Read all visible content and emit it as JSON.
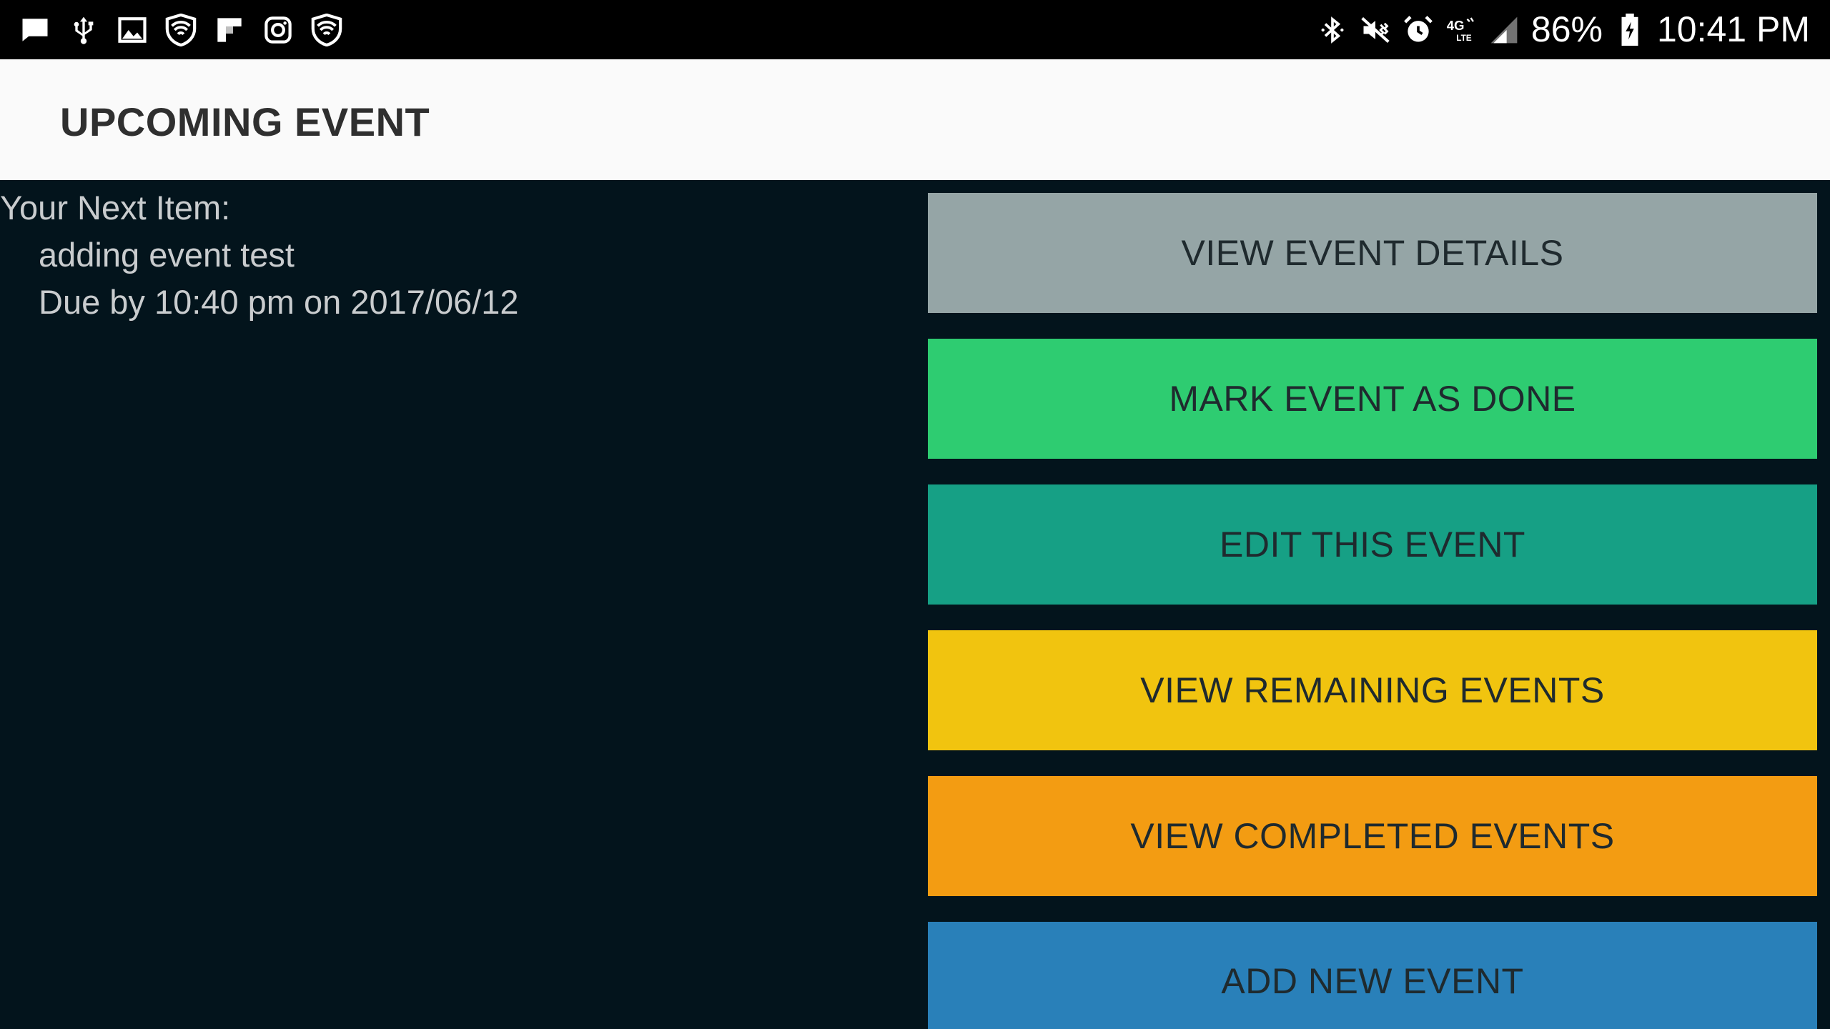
{
  "status_bar": {
    "battery": "86%",
    "time": "10:41 PM",
    "left_icons": [
      "message-icon",
      "usb-icon",
      "image-icon",
      "shield-wifi-icon",
      "flipboard-icon",
      "instagram-icon",
      "shield-wifi-icon"
    ],
    "right_icons": [
      "bluetooth-icon",
      "mute-icon",
      "alarm-icon",
      "lte-icon",
      "signal-icon",
      "battery-icon"
    ]
  },
  "app_bar": {
    "title": "UPCOMING EVENT"
  },
  "event": {
    "heading": "Your Next Item:",
    "name": "adding event test",
    "due": "Due by 10:40 pm on 2017/06/12"
  },
  "buttons": [
    {
      "label": "VIEW EVENT DETAILS",
      "color": "#95a5a6"
    },
    {
      "label": "MARK EVENT AS DONE",
      "color": "#2ecc71"
    },
    {
      "label": "EDIT THIS EVENT",
      "color": "#16a085"
    },
    {
      "label": "VIEW REMAINING EVENTS",
      "color": "#f1c40f"
    },
    {
      "label": "VIEW COMPLETED EVENTS",
      "color": "#f39c12"
    },
    {
      "label": "ADD NEW EVENT",
      "color": "#2980b9"
    }
  ],
  "colors": {
    "background": "#03141c",
    "app_bar": "#fafafa",
    "status_bar": "#000000"
  }
}
